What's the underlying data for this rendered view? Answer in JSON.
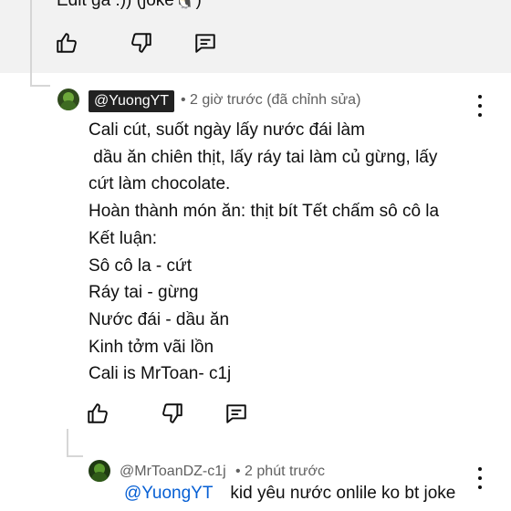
{
  "previous_comment": {
    "text_tail": "Edit ga :)) (joke🐧)"
  },
  "comment": {
    "author": "@YuongYT",
    "meta": "• 2 giờ trước (đã chỉnh sửa)",
    "lines": [
      "Cali cút, suốt ngày lấy nước đái làm",
      " dầu ăn chiên thịt, lấy ráy tai làm củ gừng, lấy",
      "cứt làm chocolate.",
      "Hoàn thành món ăn: thịt bít Tết chấm sô cô la",
      "Kết luận:",
      "Sô cô la - cứt",
      "Ráy tai - gừng",
      "Nước đái - dầu ăn",
      "Kinh tởm vãi lồn",
      "Cali is MrToan- c1j"
    ]
  },
  "reply": {
    "author": "@MrToanDZ-c1j",
    "meta": "• 2 phút trước",
    "mention": "@YuongYT",
    "text": "kid yêu nước onlile ko bt joke"
  },
  "icons": {
    "like": "thumbs-up-icon",
    "dislike": "thumbs-down-icon",
    "reply": "reply-comment-icon",
    "more": "more-vertical-icon"
  },
  "colors": {
    "mention": "#065fd4",
    "meta": "#606060",
    "author_chip_bg": "#222222",
    "top_band": "#f2f2f2"
  }
}
